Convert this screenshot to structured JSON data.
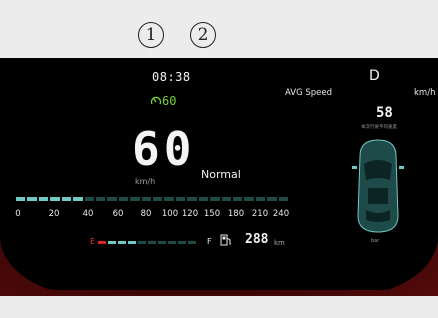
{
  "callouts": [
    {
      "number": "1"
    },
    {
      "number": "2"
    }
  ],
  "cluster": {
    "clock": "08:38",
    "speed_limit": "60",
    "speed": "60",
    "speed_unit": "km/h",
    "drive_mode": "Normal",
    "speed_scale_ticks": [
      "0",
      "20",
      "40",
      "60",
      "80",
      "100",
      "120",
      "150",
      "180",
      "210",
      "240"
    ],
    "speed_bar_fraction": 0.25,
    "fuel": {
      "empty_label": "E",
      "full_label": "F",
      "level_fraction": 0.3,
      "range_value": "288",
      "range_unit": "km"
    },
    "right_panel": {
      "gear": "D",
      "avg_label": "AVG Speed",
      "avg_unit": "km/h",
      "avg_value": "58",
      "avg_sub_label": "本次行驶平均速度",
      "car_label": "bar"
    }
  },
  "colors": {
    "accent_teal": "#6fc9c4",
    "limit_green": "#6fd23c",
    "fuel_red": "#dd2222",
    "frame_red": "#3a0606"
  },
  "icons": [
    "speed-limit-gauge-icon",
    "fuel-pump-icon",
    "car-top-view-icon"
  ]
}
